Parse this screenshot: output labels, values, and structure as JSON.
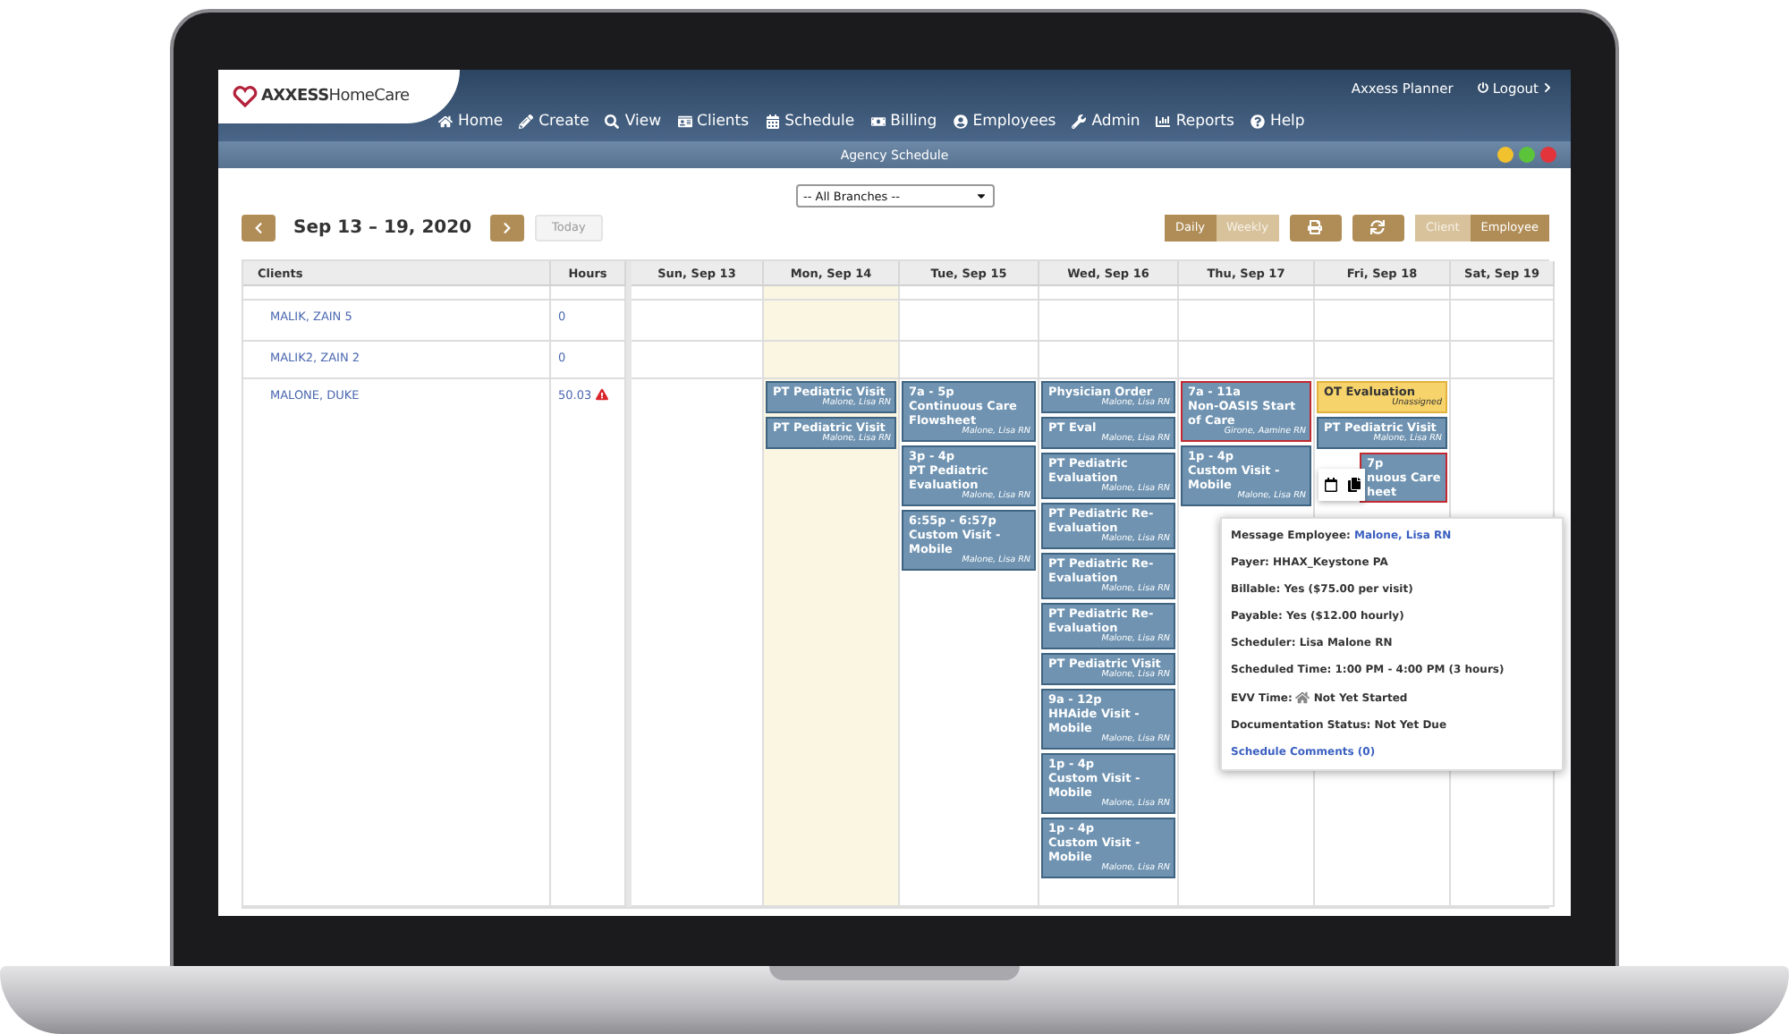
{
  "header": {
    "logo": "**AXXESS**HomeCare",
    "user": "Axxess Planner",
    "logout": "Logout",
    "nav": [
      "Home",
      "Create",
      "View",
      "Clients",
      "Schedule",
      "Billing",
      "Employees",
      "Admin",
      "Reports",
      "Help"
    ]
  },
  "window": {
    "title": "Agency Schedule"
  },
  "branch_select": {
    "value": "-- All Branches --"
  },
  "toolbar": {
    "range": "Sep 13 – 19, 2020",
    "today": {
      "label": "Today",
      "disabled": true
    },
    "view_toggle": [
      {
        "label": "Daily",
        "selected": false
      },
      {
        "label": "Weekly",
        "selected": true
      }
    ],
    "mode_toggle": [
      {
        "label": "Client",
        "selected": true
      },
      {
        "label": "Employee",
        "selected": false
      }
    ]
  },
  "table": {
    "columns": [
      "Clients",
      "Hours"
    ],
    "days": [
      {
        "label": "Sun, Sep 13",
        "today": false
      },
      {
        "label": "Mon, Sep 14",
        "today": true
      },
      {
        "label": "Tue, Sep 15",
        "today": false
      },
      {
        "label": "Wed, Sep 16",
        "today": false
      },
      {
        "label": "Thu, Sep 17",
        "today": false
      },
      {
        "label": "Fri, Sep 18",
        "today": false
      },
      {
        "label": "Sat, Sep 19",
        "today": false
      }
    ],
    "rows": [
      {
        "client": "MALIK, ZAIN 5",
        "hours": "0",
        "warning": false
      },
      {
        "client": "MALIK2, ZAIN 2",
        "hours": "0",
        "warning": false
      },
      {
        "client": "MALONE, DUKE",
        "hours": "50.03",
        "warning": true,
        "visits": {
          "mon": [
            {
              "title": "PT Pediatric Visit",
              "staff": "Malone, Lisa RN",
              "kind": "normal"
            },
            {
              "title": "PT Pediatric Visit",
              "staff": "Malone, Lisa RN",
              "kind": "normal"
            }
          ],
          "tue": [
            {
              "time": "7a - 5p",
              "title": "Continuous Care Flowsheet",
              "staff": "Malone, Lisa RN",
              "kind": "normal"
            },
            {
              "time": "3p - 4p",
              "title": "PT Pediatric Evaluation",
              "staff": "Malone, Lisa RN",
              "kind": "normal"
            },
            {
              "time": "6:55p - 6:57p",
              "title": "Custom Visit - Mobile",
              "staff": "Malone, Lisa RN",
              "kind": "normal"
            }
          ],
          "wed": [
            {
              "title": "Physician Order",
              "staff": "Malone, Lisa RN",
              "kind": "normal"
            },
            {
              "title": "PT Eval",
              "staff": "Malone, Lisa RN",
              "kind": "normal"
            },
            {
              "title": "PT Pediatric Evaluation",
              "staff": "Malone, Lisa RN",
              "kind": "normal"
            },
            {
              "title": "PT Pediatric Re-Evaluation",
              "staff": "Malone, Lisa RN",
              "kind": "normal"
            },
            {
              "title": "PT Pediatric Re-Evaluation",
              "staff": "Malone, Lisa RN",
              "kind": "normal"
            },
            {
              "title": "PT Pediatric Re-Evaluation",
              "staff": "Malone, Lisa RN",
              "kind": "normal"
            },
            {
              "title": "PT Pediatric Visit",
              "staff": "Malone, Lisa RN",
              "kind": "normal"
            },
            {
              "time": "9a - 12p",
              "title": "HHAide Visit - Mobile",
              "staff": "Malone, Lisa RN",
              "kind": "normal"
            },
            {
              "time": "1p - 4p",
              "title": "Custom Visit - Mobile",
              "staff": "Malone, Lisa RN",
              "kind": "normal"
            },
            {
              "time": "1p - 4p",
              "title": "Custom Visit - Mobile",
              "staff": "Malone, Lisa RN",
              "kind": "normal"
            }
          ],
          "thu": [
            {
              "time": "7a - 11a",
              "title": "Non-OASIS Start of Care",
              "staff": "Girone, Aamine RN",
              "kind": "flagged"
            },
            {
              "time": "1p - 4p",
              "title": "Custom Visit - Mobile",
              "staff": "Malone, Lisa RN",
              "kind": "normal"
            }
          ],
          "fri": [
            {
              "title": "OT Evaluation",
              "staff": "Unassigned",
              "kind": "unassigned"
            },
            {
              "title": "PT Pediatric Visit",
              "staff": "Malone, Lisa RN",
              "kind": "normal"
            },
            {
              "time": "7p",
              "title": "nuous Care heet",
              "kind": "flagged",
              "partial": true
            }
          ]
        }
      }
    ]
  },
  "popup": {
    "lines": [
      {
        "kind": "link",
        "label": "Message Employee:",
        "value": "Malone, Lisa RN"
      },
      {
        "kind": "text",
        "label": "Payer:",
        "value": "HHAX_Keystone PA"
      },
      {
        "kind": "text",
        "label": "Billable:",
        "value": "Yes ($75.00 per visit)"
      },
      {
        "kind": "text",
        "label": "Payable:",
        "value": "Yes ($12.00 hourly)"
      },
      {
        "kind": "text",
        "label": "Scheduler:",
        "value": "Lisa Malone RN"
      },
      {
        "kind": "text",
        "label": "Scheduled Time:",
        "value": "1:00 PM - 4:00 PM (3 hours)"
      },
      {
        "kind": "evv",
        "label": "EVV Time:",
        "value": "Not Yet Started"
      },
      {
        "kind": "text",
        "label": "Documentation Status:",
        "value": "Not Yet Due"
      }
    ],
    "comments_link": "Schedule Comments (0)"
  }
}
